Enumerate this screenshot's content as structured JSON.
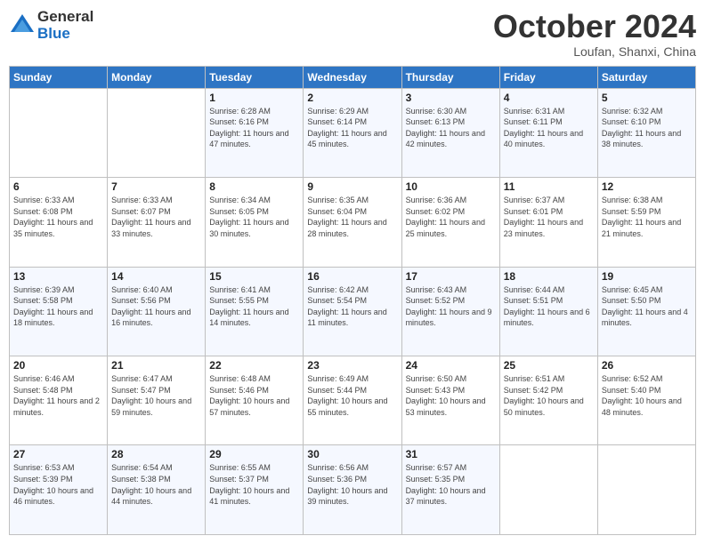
{
  "logo": {
    "general": "General",
    "blue": "Blue"
  },
  "header": {
    "month": "October 2024",
    "location": "Loufan, Shanxi, China"
  },
  "days_of_week": [
    "Sunday",
    "Monday",
    "Tuesday",
    "Wednesday",
    "Thursday",
    "Friday",
    "Saturday"
  ],
  "weeks": [
    [
      {
        "num": "",
        "info": ""
      },
      {
        "num": "",
        "info": ""
      },
      {
        "num": "1",
        "info": "Sunrise: 6:28 AM\nSunset: 6:16 PM\nDaylight: 11 hours and 47 minutes."
      },
      {
        "num": "2",
        "info": "Sunrise: 6:29 AM\nSunset: 6:14 PM\nDaylight: 11 hours and 45 minutes."
      },
      {
        "num": "3",
        "info": "Sunrise: 6:30 AM\nSunset: 6:13 PM\nDaylight: 11 hours and 42 minutes."
      },
      {
        "num": "4",
        "info": "Sunrise: 6:31 AM\nSunset: 6:11 PM\nDaylight: 11 hours and 40 minutes."
      },
      {
        "num": "5",
        "info": "Sunrise: 6:32 AM\nSunset: 6:10 PM\nDaylight: 11 hours and 38 minutes."
      }
    ],
    [
      {
        "num": "6",
        "info": "Sunrise: 6:33 AM\nSunset: 6:08 PM\nDaylight: 11 hours and 35 minutes."
      },
      {
        "num": "7",
        "info": "Sunrise: 6:33 AM\nSunset: 6:07 PM\nDaylight: 11 hours and 33 minutes."
      },
      {
        "num": "8",
        "info": "Sunrise: 6:34 AM\nSunset: 6:05 PM\nDaylight: 11 hours and 30 minutes."
      },
      {
        "num": "9",
        "info": "Sunrise: 6:35 AM\nSunset: 6:04 PM\nDaylight: 11 hours and 28 minutes."
      },
      {
        "num": "10",
        "info": "Sunrise: 6:36 AM\nSunset: 6:02 PM\nDaylight: 11 hours and 25 minutes."
      },
      {
        "num": "11",
        "info": "Sunrise: 6:37 AM\nSunset: 6:01 PM\nDaylight: 11 hours and 23 minutes."
      },
      {
        "num": "12",
        "info": "Sunrise: 6:38 AM\nSunset: 5:59 PM\nDaylight: 11 hours and 21 minutes."
      }
    ],
    [
      {
        "num": "13",
        "info": "Sunrise: 6:39 AM\nSunset: 5:58 PM\nDaylight: 11 hours and 18 minutes."
      },
      {
        "num": "14",
        "info": "Sunrise: 6:40 AM\nSunset: 5:56 PM\nDaylight: 11 hours and 16 minutes."
      },
      {
        "num": "15",
        "info": "Sunrise: 6:41 AM\nSunset: 5:55 PM\nDaylight: 11 hours and 14 minutes."
      },
      {
        "num": "16",
        "info": "Sunrise: 6:42 AM\nSunset: 5:54 PM\nDaylight: 11 hours and 11 minutes."
      },
      {
        "num": "17",
        "info": "Sunrise: 6:43 AM\nSunset: 5:52 PM\nDaylight: 11 hours and 9 minutes."
      },
      {
        "num": "18",
        "info": "Sunrise: 6:44 AM\nSunset: 5:51 PM\nDaylight: 11 hours and 6 minutes."
      },
      {
        "num": "19",
        "info": "Sunrise: 6:45 AM\nSunset: 5:50 PM\nDaylight: 11 hours and 4 minutes."
      }
    ],
    [
      {
        "num": "20",
        "info": "Sunrise: 6:46 AM\nSunset: 5:48 PM\nDaylight: 11 hours and 2 minutes."
      },
      {
        "num": "21",
        "info": "Sunrise: 6:47 AM\nSunset: 5:47 PM\nDaylight: 10 hours and 59 minutes."
      },
      {
        "num": "22",
        "info": "Sunrise: 6:48 AM\nSunset: 5:46 PM\nDaylight: 10 hours and 57 minutes."
      },
      {
        "num": "23",
        "info": "Sunrise: 6:49 AM\nSunset: 5:44 PM\nDaylight: 10 hours and 55 minutes."
      },
      {
        "num": "24",
        "info": "Sunrise: 6:50 AM\nSunset: 5:43 PM\nDaylight: 10 hours and 53 minutes."
      },
      {
        "num": "25",
        "info": "Sunrise: 6:51 AM\nSunset: 5:42 PM\nDaylight: 10 hours and 50 minutes."
      },
      {
        "num": "26",
        "info": "Sunrise: 6:52 AM\nSunset: 5:40 PM\nDaylight: 10 hours and 48 minutes."
      }
    ],
    [
      {
        "num": "27",
        "info": "Sunrise: 6:53 AM\nSunset: 5:39 PM\nDaylight: 10 hours and 46 minutes."
      },
      {
        "num": "28",
        "info": "Sunrise: 6:54 AM\nSunset: 5:38 PM\nDaylight: 10 hours and 44 minutes."
      },
      {
        "num": "29",
        "info": "Sunrise: 6:55 AM\nSunset: 5:37 PM\nDaylight: 10 hours and 41 minutes."
      },
      {
        "num": "30",
        "info": "Sunrise: 6:56 AM\nSunset: 5:36 PM\nDaylight: 10 hours and 39 minutes."
      },
      {
        "num": "31",
        "info": "Sunrise: 6:57 AM\nSunset: 5:35 PM\nDaylight: 10 hours and 37 minutes."
      },
      {
        "num": "",
        "info": ""
      },
      {
        "num": "",
        "info": ""
      }
    ]
  ]
}
